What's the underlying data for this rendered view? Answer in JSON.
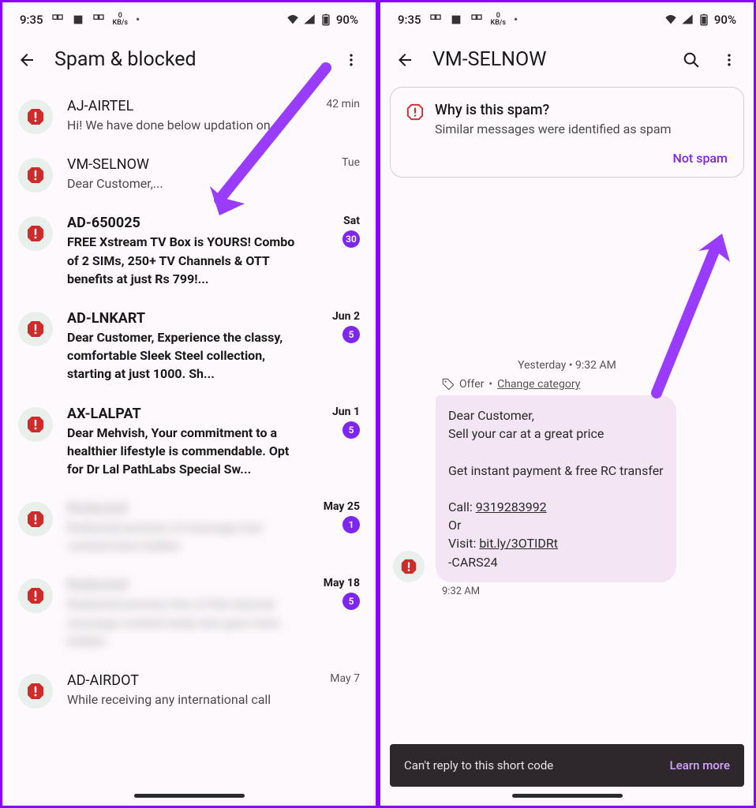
{
  "status": {
    "time": "9:35",
    "kb": "0",
    "kbs": "KB/s",
    "battery": "90%"
  },
  "left": {
    "title": "Spam & blocked",
    "rows": [
      {
        "sender": "AJ-AIRTEL",
        "preview": "Hi! We have done below updation on ...",
        "time": "42 min",
        "unread": false,
        "badge": null
      },
      {
        "sender": "VM-SELNOW",
        "preview": "Dear Customer,...",
        "time": "Tue",
        "unread": false,
        "badge": null
      },
      {
        "sender": "AD-650025",
        "preview": "FREE Xstream TV Box is YOURS! Combo of 2 SIMs, 250+ TV Channels & OTT benefits at just Rs 799!...",
        "time": "Sat",
        "unread": true,
        "badge": "30"
      },
      {
        "sender": "AD-LNKART",
        "preview": "Dear Customer, Experience the classy, comfortable Sleek Steel collection, starting at just 1000. Sh...",
        "time": "Jun 2",
        "unread": true,
        "badge": "5"
      },
      {
        "sender": "AX-LALPAT",
        "preview": "Dear Mehvish, Your commitment to a healthier lifestyle is commendable. Opt for Dr Lal PathLabs Special Sw...",
        "time": "Jun 1",
        "unread": true,
        "badge": "5"
      },
      {
        "sender": "Redacted",
        "preview": "Redacted preview of message text content here hidden",
        "time": "May 25",
        "unread": true,
        "badge": "1"
      },
      {
        "sender": "Redacted",
        "preview": "Redacted preview line of this blurred message content body text goes here hidden",
        "time": "May 18",
        "unread": true,
        "badge": "5"
      },
      {
        "sender": "AD-AIRDOT",
        "preview": "While receiving any international call",
        "time": "May 7",
        "unread": false,
        "badge": null
      }
    ]
  },
  "right": {
    "title": "VM-SELNOW",
    "card": {
      "title": "Why is this spam?",
      "subtitle": "Similar messages were identified as spam",
      "action": "Not spam"
    },
    "chat_date": "Yesterday • 9:32 AM",
    "offer_label": "Offer",
    "change_category": "Change category",
    "message": {
      "line1": "Dear Customer,",
      "line2": "Sell your car at a great price",
      "line3": "Get instant payment & free RC transfer",
      "call_label": "Call: ",
      "phone": "9319283992",
      "or": "Or",
      "visit_label": "Visit: ",
      "link": "bit.ly/3OTIDRt",
      "signature": "-CARS24",
      "time": "9:32 AM"
    },
    "footer": {
      "text": "Can't reply to this short code",
      "action": "Learn more"
    }
  }
}
